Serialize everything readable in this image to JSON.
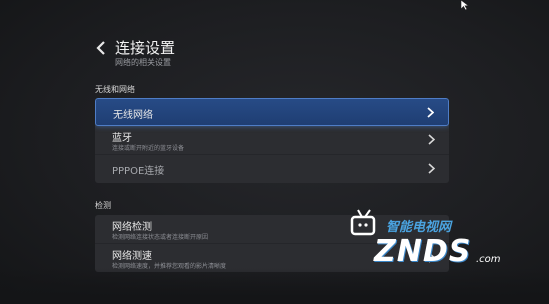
{
  "header": {
    "title": "连接设置",
    "subtitle": "网络的相关设置"
  },
  "sections": [
    {
      "label": "无线和网络",
      "items": [
        {
          "label": "无线网络",
          "desc": "",
          "selected": true
        },
        {
          "label": "蓝牙",
          "desc": "连接或断开附近的蓝牙设备",
          "selected": false
        },
        {
          "label": "PPPOE连接",
          "desc": "",
          "selected": false
        }
      ]
    },
    {
      "label": "检测",
      "items": [
        {
          "label": "网络检测",
          "desc": "检测网络连接状态或者连接断开原因"
        },
        {
          "label": "网络测速",
          "desc": "检测网络速度，并推荐您观看的影片清晰度"
        }
      ]
    }
  ],
  "watermark": {
    "title": "智能电视网",
    "logo": "ZNDS",
    "suffix": ".com"
  },
  "colors": {
    "selected": "#274b86",
    "selected_border": "#4f7dc6",
    "item_bg": "#2c2d31",
    "watermark_accent": "#4aa3e0"
  }
}
